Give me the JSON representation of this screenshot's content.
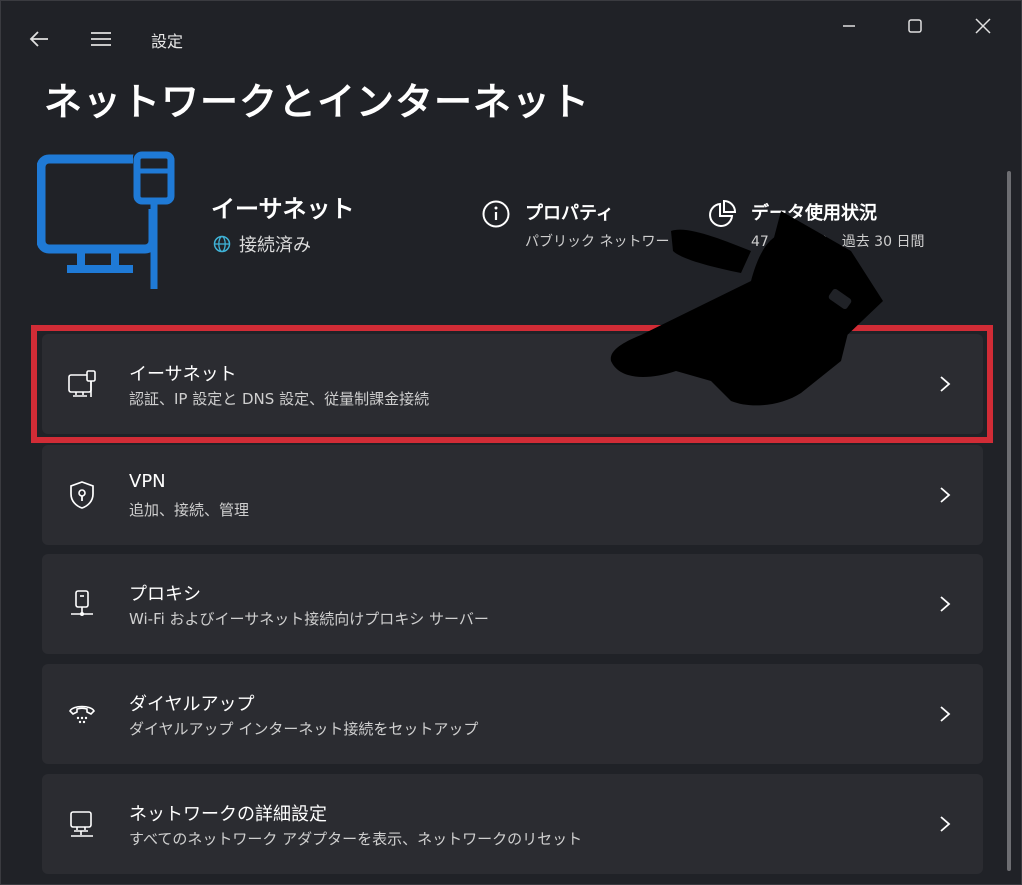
{
  "window": {
    "app_title": "設定",
    "page_title": "ネットワークとインターネット"
  },
  "hero": {
    "name": "イーサネット",
    "status": "接続済み",
    "properties": {
      "title": "プロパティ",
      "subtitle": "パブリック ネットワー"
    },
    "data_usage": {
      "title": "データ使用状況",
      "subtitle": "47",
      "subtitle_end": "3、過去 30 日間"
    }
  },
  "items": [
    {
      "title": "イーサネット",
      "subtitle": "認証、IP 設定と DNS 設定、従量制課金接続",
      "icon": "ethernet-icon"
    },
    {
      "title": "VPN",
      "subtitle": "追加、接続、管理",
      "icon": "vpn-shield-icon"
    },
    {
      "title": "プロキシ",
      "subtitle": "Wi-Fi およびイーサネット接続向けプロキシ サーバー",
      "icon": "proxy-icon"
    },
    {
      "title": "ダイヤルアップ",
      "subtitle": "ダイヤルアップ インターネット接続をセットアップ",
      "icon": "dialup-icon"
    },
    {
      "title": "ネットワークの詳細設定",
      "subtitle": "すべてのネットワーク アダプターを表示、ネットワークのリセット",
      "icon": "network-advanced-icon"
    }
  ],
  "colors": {
    "background": "#202227",
    "card": "#2b2c31",
    "accent": "#1f7ad6",
    "highlight": "#d12c36"
  }
}
